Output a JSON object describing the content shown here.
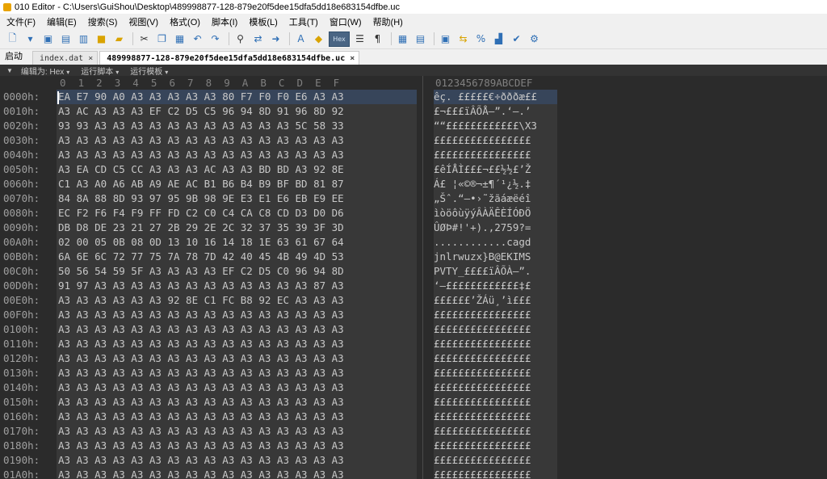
{
  "window": {
    "title": "010 Editor - C:\\Users\\GuiShou\\Desktop\\489998877-128-879e20f5dee15dfa5dd18e683154dfbe.uc"
  },
  "menu": [
    "文件(F)",
    "编辑(E)",
    "搜索(S)",
    "视图(V)",
    "格式(O)",
    "脚本(I)",
    "模板(L)",
    "工具(T)",
    "窗口(W)",
    "帮助(H)"
  ],
  "toolbar": {
    "icons": [
      "new-file-icon",
      "open-file-icon",
      "save-icon",
      "save-all-icon",
      "copy-file-icon",
      "folder-icon",
      "folders-icon",
      "cut-icon",
      "copy-icon",
      "paste-icon",
      "undo-icon",
      "redo-icon",
      "find-icon",
      "find-replace-icon",
      "goto-icon",
      "font-icon",
      "highlight-icon",
      "hex-mode-icon",
      "columns-icon",
      "paragraph-icon",
      "grid-icon",
      "compare-icon",
      "calculator-icon",
      "swap-icon",
      "percent-icon",
      "chart-icon",
      "check-icon",
      "settings-icon"
    ],
    "hex_label": "Hex"
  },
  "tabs": {
    "start_label": "启动",
    "items": [
      {
        "label": "index.dat",
        "active": false
      },
      {
        "label": "489998877-128-879e20f5dee15dfa5dd18e683154dfbe.uc",
        "active": true
      }
    ],
    "close_glyph": "×"
  },
  "subbar": {
    "edit_mode": "编辑为: Hex",
    "run_script": "运行脚本",
    "run_template": "运行模板"
  },
  "editor": {
    "hex_header": "0  1  2  3  4  5  6  7  8  9  A  B  C  D  E  F",
    "ascii_header": "0123456789ABCDEF",
    "rows": [
      {
        "addr": "0000h:",
        "hex": "EA E7 90 A0 A3 A3 A3 A3 A3 80 F7 F0 F0 E6 A3 A3",
        "ascii": "êç. £££££€÷ðððæ££"
      },
      {
        "addr": "0010h:",
        "hex": "A3 AC A3 A3 A3 EF C2 D5 C5 96 94 8D 91 96 8D 92",
        "ascii": "£¬£££ïÂÕÅ–”.‘–.’"
      },
      {
        "addr": "0020h:",
        "hex": "93 93 A3 A3 A3 A3 A3 A3 A3 A3 A3 A3 A3 5C 58 33",
        "ascii": "““££££££££££££\\X3"
      },
      {
        "addr": "0030h:",
        "hex": "A3 A3 A3 A3 A3 A3 A3 A3 A3 A3 A3 A3 A3 A3 A3 A3",
        "ascii": "££££££££££££££££"
      },
      {
        "addr": "0040h:",
        "hex": "A3 A3 A3 A3 A3 A3 A3 A3 A3 A3 A3 A3 A3 A3 A3 A3",
        "ascii": "££££££££££££££££"
      },
      {
        "addr": "0050h:",
        "hex": "A3 EA CD C5 CC A3 A3 A3 AC A3 A3 BD BD A3 92 8E",
        "ascii": "£êÍÅÌ£££¬££½½£’Ž"
      },
      {
        "addr": "0060h:",
        "hex": "C1 A3 A0 A6 AB A9 AE AC B1 B6 B4 B9 BF BD 81 87",
        "ascii": "Á£ ¦«©®¬±¶´¹¿½.‡"
      },
      {
        "addr": "0070h:",
        "hex": "84 8A 88 8D 93 97 95 9B 98 9E E3 E1 E6 EB E9 EE",
        "ascii": "„Šˆ.“—•›˜žãáæëéî"
      },
      {
        "addr": "0080h:",
        "hex": "EC F2 F6 F4 F9 FF FD C2 C0 C4 CA C8 CD D3 D0 D6",
        "ascii": "ìòöôùÿýÂÀÄÊÈÍÓÐÖ"
      },
      {
        "addr": "0090h:",
        "hex": "DB D8 DE 23 21 27 2B 29 2E 2C 32 37 35 39 3F 3D",
        "ascii": "ÛØÞ#!'+).,2759?="
      },
      {
        "addr": "00A0h:",
        "hex": "02 00 05 0B 08 0D 13 10 16 14 18 1E 63 61 67 64",
        "ascii": "............cagd"
      },
      {
        "addr": "00B0h:",
        "hex": "6A 6E 6C 72 77 75 7A 78 7D 42 40 45 4B 49 4D 53",
        "ascii": "jnlrwuzx}B@EKIMS"
      },
      {
        "addr": "00C0h:",
        "hex": "50 56 54 59 5F A3 A3 A3 A3 EF C2 D5 C0 96 94 8D",
        "ascii": "PVTY_££££ïÂÕÀ–”."
      },
      {
        "addr": "00D0h:",
        "hex": "91 97 A3 A3 A3 A3 A3 A3 A3 A3 A3 A3 A3 A3 87 A3",
        "ascii": "‘—££££££££££££‡£"
      },
      {
        "addr": "00E0h:",
        "hex": "A3 A3 A3 A3 A3 A3 92 8E C1 FC B8 92 EC A3 A3 A3",
        "ascii": "££££££’ŽÁü¸’ì£££"
      },
      {
        "addr": "00F0h:",
        "hex": "A3 A3 A3 A3 A3 A3 A3 A3 A3 A3 A3 A3 A3 A3 A3 A3",
        "ascii": "££££££££££££££££"
      },
      {
        "addr": "0100h:",
        "hex": "A3 A3 A3 A3 A3 A3 A3 A3 A3 A3 A3 A3 A3 A3 A3 A3",
        "ascii": "££££££££££££££££"
      },
      {
        "addr": "0110h:",
        "hex": "A3 A3 A3 A3 A3 A3 A3 A3 A3 A3 A3 A3 A3 A3 A3 A3",
        "ascii": "££££££££££££££££"
      },
      {
        "addr": "0120h:",
        "hex": "A3 A3 A3 A3 A3 A3 A3 A3 A3 A3 A3 A3 A3 A3 A3 A3",
        "ascii": "££££££££££££££££"
      },
      {
        "addr": "0130h:",
        "hex": "A3 A3 A3 A3 A3 A3 A3 A3 A3 A3 A3 A3 A3 A3 A3 A3",
        "ascii": "££££££££££££££££"
      },
      {
        "addr": "0140h:",
        "hex": "A3 A3 A3 A3 A3 A3 A3 A3 A3 A3 A3 A3 A3 A3 A3 A3",
        "ascii": "££££££££££££££££"
      },
      {
        "addr": "0150h:",
        "hex": "A3 A3 A3 A3 A3 A3 A3 A3 A3 A3 A3 A3 A3 A3 A3 A3",
        "ascii": "££££££££££££££££"
      },
      {
        "addr": "0160h:",
        "hex": "A3 A3 A3 A3 A3 A3 A3 A3 A3 A3 A3 A3 A3 A3 A3 A3",
        "ascii": "££££££££££££££££"
      },
      {
        "addr": "0170h:",
        "hex": "A3 A3 A3 A3 A3 A3 A3 A3 A3 A3 A3 A3 A3 A3 A3 A3",
        "ascii": "££££££££££££££££"
      },
      {
        "addr": "0180h:",
        "hex": "A3 A3 A3 A3 A3 A3 A3 A3 A3 A3 A3 A3 A3 A3 A3 A3",
        "ascii": "££££££££££££££££"
      },
      {
        "addr": "0190h:",
        "hex": "A3 A3 A3 A3 A3 A3 A3 A3 A3 A3 A3 A3 A3 A3 A3 A3",
        "ascii": "££££££££££££££££"
      },
      {
        "addr": "01A0h:",
        "hex": "A3 A3 A3 A3 A3 A3 A3 A3 A3 A3 A3 A3 A3 A3 A3 A3",
        "ascii": "££££££££££££££££"
      }
    ]
  },
  "colors": {
    "editor_bg": "#2b2b2b",
    "row_bg": "#383838",
    "selected_row_bg": "#37455a",
    "text": "#c8c8c8"
  }
}
